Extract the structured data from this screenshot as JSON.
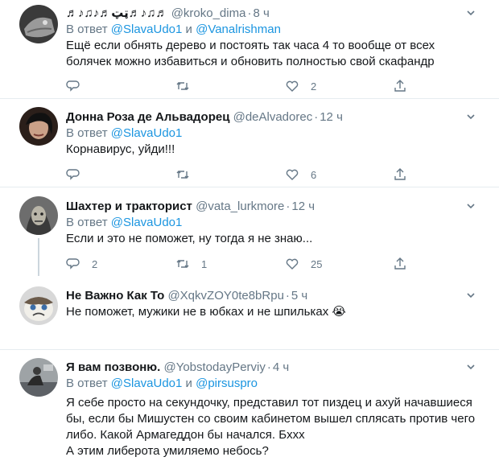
{
  "replying_to_label": "В ответ",
  "and_label": "и",
  "tweets": [
    {
      "name": "♬♪♫♪♬ټټ♬♪♫♬",
      "handle": "@kroko_dima",
      "time": "8 ч",
      "mentions": [
        "@SlavaUdo1",
        "@Vanalrishman"
      ],
      "lines": [
        "Ещё если обнять дерево и постоять так часа 4 то вообще от всех",
        "болячек можно избавиться и обновить полностью свой скафандр"
      ],
      "reply_count": "",
      "retweet_count": "",
      "like_count": "2"
    },
    {
      "name": "Донна Роза де Альвадорец",
      "handle": "@deAlvadorec",
      "time": "12 ч",
      "mentions": [
        "@SlavaUdo1"
      ],
      "lines": [
        "Корнавирус, уйди!!!"
      ],
      "reply_count": "",
      "retweet_count": "",
      "like_count": "6"
    },
    {
      "name": "Шахтер и тракторист",
      "handle": "@vata_lurkmore",
      "time": "12 ч",
      "mentions": [
        "@SlavaUdo1"
      ],
      "lines": [
        "Если и это не поможет, ну тогда я не знаю..."
      ],
      "reply_count": "2",
      "retweet_count": "1",
      "like_count": "25"
    },
    {
      "name": "Не Важно Как То",
      "handle": "@XqkvZOY0te8bRpu",
      "time": "5 ч",
      "mentions": [],
      "lines": [
        "Не поможет, мужики не в юбках и не шпильках 😭"
      ],
      "reply_count": "",
      "retweet_count": "",
      "like_count": ""
    },
    {
      "name": "Я вам позвоню.",
      "handle": "@YobstodayPerviy",
      "time": "4 ч",
      "mentions": [
        "@SlavaUdo1",
        "@pirsuspro"
      ],
      "lines": [
        "Я себе просто на секундочку, представил тот пиздец и ахуй начавшиеся",
        "бы, если бы Мишустен со своим кабинетом вышел сплясать против чего",
        "либо. Какой Армагеддон бы начался. Бххх",
        "А этим либерота умиляемо небось?"
      ],
      "reply_count": "",
      "retweet_count": "",
      "like_count": ""
    }
  ],
  "colors": {
    "accent": "#1b95e0",
    "muted": "#657786",
    "text": "#14171a",
    "separator": "#e6ecf0"
  }
}
